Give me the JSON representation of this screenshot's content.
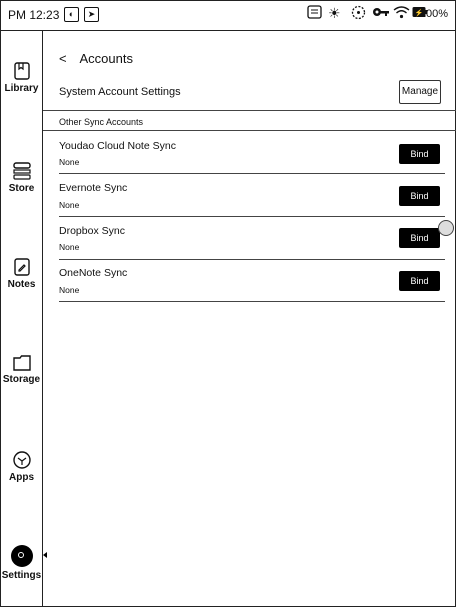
{
  "status_bar": {
    "time": "PM 12:23",
    "battery": "100%",
    "icons": [
      "sync-icon",
      "navigation-icon",
      "note-icon",
      "brightness-icon",
      "refresh-icon",
      "key-icon",
      "wifi-icon",
      "battery-icon"
    ]
  },
  "sidebar": {
    "items": [
      {
        "label": "Library",
        "icon": "book-icon"
      },
      {
        "label": "Store",
        "icon": "store-icon"
      },
      {
        "label": "Notes",
        "icon": "notes-icon"
      },
      {
        "label": "Storage",
        "icon": "folder-icon"
      },
      {
        "label": "Apps",
        "icon": "apps-icon"
      },
      {
        "label": "Settings",
        "icon": "settings-icon",
        "active": true
      }
    ]
  },
  "page": {
    "title": "Accounts",
    "system_account": {
      "label": "System Account Settings",
      "button": "Manage"
    },
    "section_title": "Other Sync Accounts",
    "sync_accounts": [
      {
        "name": "Youdao Cloud Note Sync",
        "status": "None",
        "button": "Bind"
      },
      {
        "name": "Evernote Sync",
        "status": "None",
        "button": "Bind"
      },
      {
        "name": "Dropbox Sync",
        "status": "None",
        "button": "Bind"
      },
      {
        "name": "OneNote Sync",
        "status": "None",
        "button": "Bind"
      }
    ]
  }
}
